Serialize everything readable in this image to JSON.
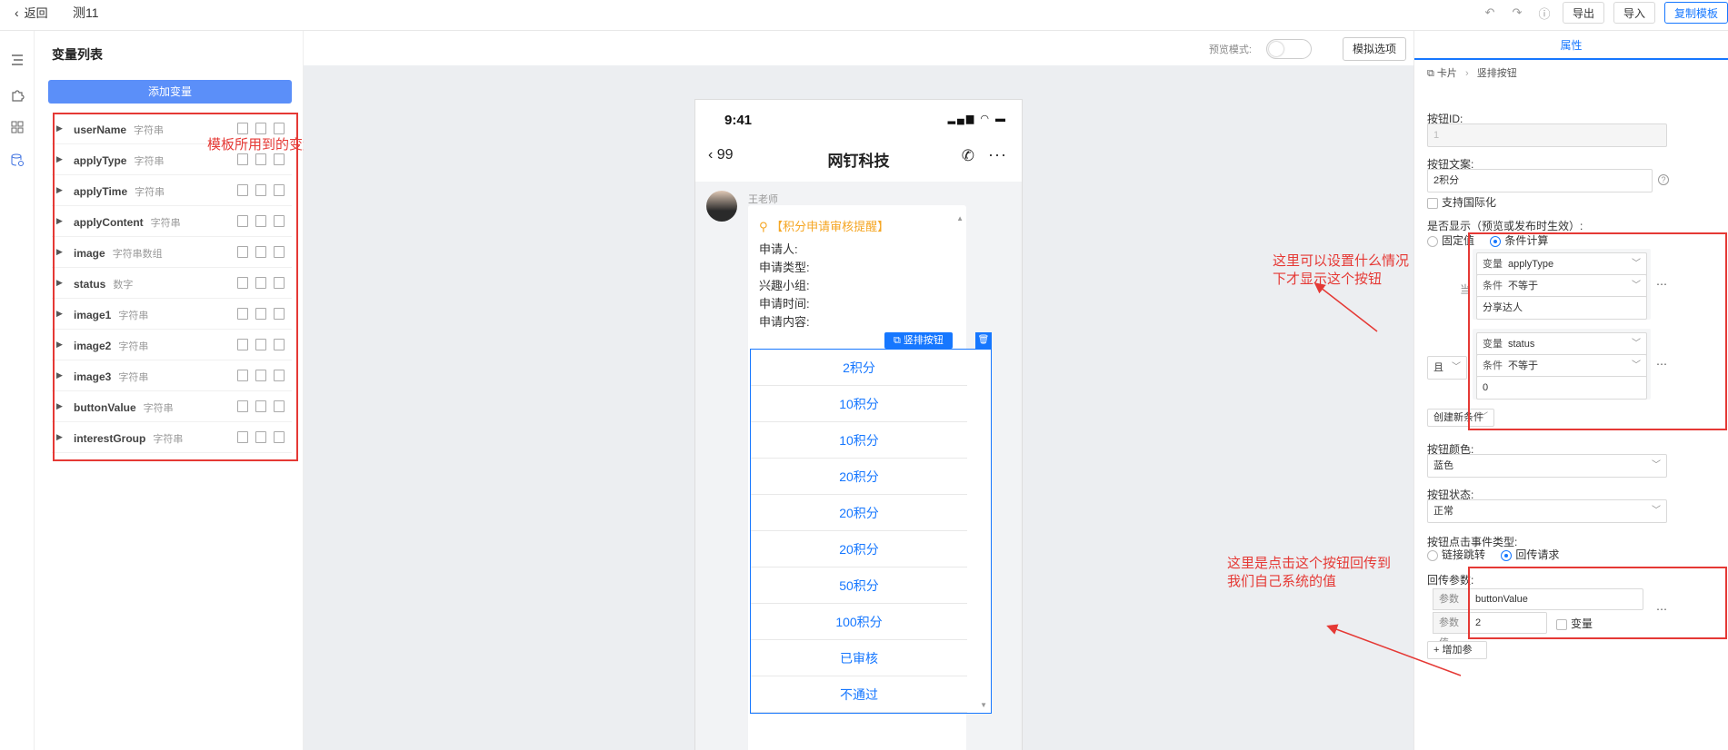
{
  "header": {
    "back_label": "返回",
    "title": "测11",
    "export_label": "导出",
    "import_label": "导入",
    "copy_template_label": "复制模板"
  },
  "vars": {
    "title": "变量列表",
    "add_label": "添加变量",
    "items": [
      {
        "name": "userName",
        "type": "字符串"
      },
      {
        "name": "applyType",
        "type": "字符串"
      },
      {
        "name": "applyTime",
        "type": "字符串"
      },
      {
        "name": "applyContent",
        "type": "字符串"
      },
      {
        "name": "image",
        "type": "字符串数组"
      },
      {
        "name": "status",
        "type": "数字"
      },
      {
        "name": "image1",
        "type": "字符串"
      },
      {
        "name": "image2",
        "type": "字符串"
      },
      {
        "name": "image3",
        "type": "字符串"
      },
      {
        "name": "buttonValue",
        "type": "字符串"
      },
      {
        "name": "interestGroup",
        "type": "字符串"
      }
    ],
    "annotation": "模板所用到的变量"
  },
  "canvas": {
    "preview_label": "预览模式:",
    "simulate_label": "模拟选项"
  },
  "phone": {
    "time": "9:41",
    "back_count": "99",
    "chat_title": "网钉科技",
    "sender": "王老师",
    "card_title": "【积分申请审核提醒】",
    "fields": [
      "申请人:",
      "申请类型:",
      "兴趣小组:",
      "申请时间:",
      "申请内容:"
    ],
    "selected_label": "竖排按钮",
    "buttons": [
      "2积分",
      "10积分",
      "10积分",
      "20积分",
      "20积分",
      "20积分",
      "50积分",
      "100积分",
      "已审核",
      "不通过"
    ]
  },
  "props": {
    "tab": "属性",
    "breadcrumb_parent": "卡片",
    "breadcrumb_current": "竖排按钮",
    "btn_id_label": "按钮ID:",
    "btn_id_value": "1",
    "btn_text_label": "按钮文案:",
    "btn_text_value": "2积分",
    "i18n_label": "支持国际化",
    "show_label": "是否显示（预览或发布时生效）:",
    "radio_fixed": "固定值",
    "radio_cond": "条件计算",
    "when_label": "当",
    "and_label": "且",
    "cond1": {
      "var_pre": "变量",
      "var": "applyType",
      "op_pre": "条件",
      "op": "不等于",
      "value": "分享达人"
    },
    "cond2": {
      "var_pre": "变量",
      "var": "status",
      "op_pre": "条件",
      "op": "不等于",
      "value": "0"
    },
    "new_cond_label": "创建新条件",
    "color_label": "按钮颜色:",
    "color_value": "蓝色",
    "state_label": "按钮状态:",
    "state_value": "正常",
    "event_label": "按钮点击事件类型:",
    "event_link": "链接跳转",
    "event_callback": "回传请求",
    "callback_label": "回传参数:",
    "param_name_key": "参数名",
    "param_name_value": "buttonValue",
    "param_val_key": "参数值",
    "param_val_value": "2",
    "param_var_label": "变量",
    "add_param_label": "+ 增加参数",
    "annotation_show": "这里可以设置什么情况下才显示这个按钮",
    "annotation_callback": "这里是点击这个按钮回传到我们自己系统的值"
  },
  "colors": {
    "primary": "#1677ff",
    "add_button": "#5b8ff9",
    "annotation_red": "#e53935",
    "card_title_orange": "#f5a623"
  }
}
